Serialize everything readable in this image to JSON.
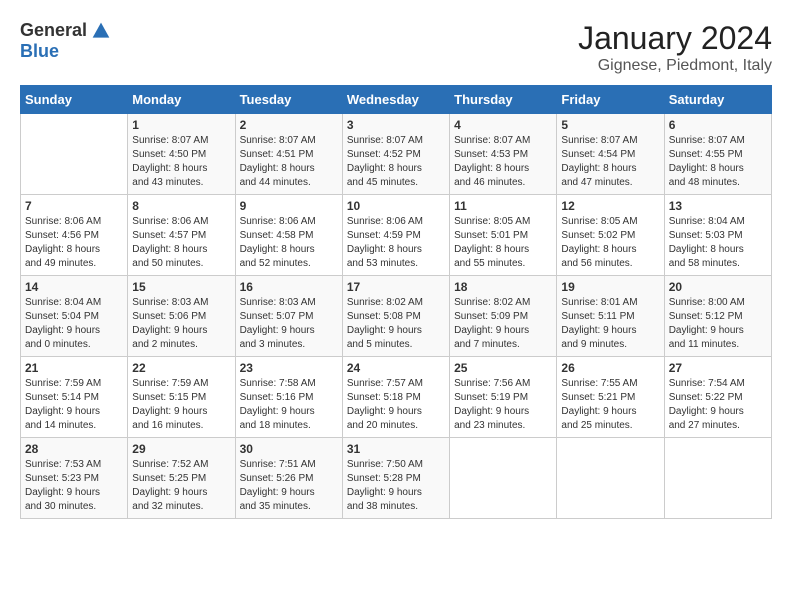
{
  "header": {
    "logo_general": "General",
    "logo_blue": "Blue",
    "month_year": "January 2024",
    "location": "Gignese, Piedmont, Italy"
  },
  "days_of_week": [
    "Sunday",
    "Monday",
    "Tuesday",
    "Wednesday",
    "Thursday",
    "Friday",
    "Saturday"
  ],
  "weeks": [
    [
      {
        "day": "",
        "info": ""
      },
      {
        "day": "1",
        "info": "Sunrise: 8:07 AM\nSunset: 4:50 PM\nDaylight: 8 hours\nand 43 minutes."
      },
      {
        "day": "2",
        "info": "Sunrise: 8:07 AM\nSunset: 4:51 PM\nDaylight: 8 hours\nand 44 minutes."
      },
      {
        "day": "3",
        "info": "Sunrise: 8:07 AM\nSunset: 4:52 PM\nDaylight: 8 hours\nand 45 minutes."
      },
      {
        "day": "4",
        "info": "Sunrise: 8:07 AM\nSunset: 4:53 PM\nDaylight: 8 hours\nand 46 minutes."
      },
      {
        "day": "5",
        "info": "Sunrise: 8:07 AM\nSunset: 4:54 PM\nDaylight: 8 hours\nand 47 minutes."
      },
      {
        "day": "6",
        "info": "Sunrise: 8:07 AM\nSunset: 4:55 PM\nDaylight: 8 hours\nand 48 minutes."
      }
    ],
    [
      {
        "day": "7",
        "info": "Sunrise: 8:06 AM\nSunset: 4:56 PM\nDaylight: 8 hours\nand 49 minutes."
      },
      {
        "day": "8",
        "info": "Sunrise: 8:06 AM\nSunset: 4:57 PM\nDaylight: 8 hours\nand 50 minutes."
      },
      {
        "day": "9",
        "info": "Sunrise: 8:06 AM\nSunset: 4:58 PM\nDaylight: 8 hours\nand 52 minutes."
      },
      {
        "day": "10",
        "info": "Sunrise: 8:06 AM\nSunset: 4:59 PM\nDaylight: 8 hours\nand 53 minutes."
      },
      {
        "day": "11",
        "info": "Sunrise: 8:05 AM\nSunset: 5:01 PM\nDaylight: 8 hours\nand 55 minutes."
      },
      {
        "day": "12",
        "info": "Sunrise: 8:05 AM\nSunset: 5:02 PM\nDaylight: 8 hours\nand 56 minutes."
      },
      {
        "day": "13",
        "info": "Sunrise: 8:04 AM\nSunset: 5:03 PM\nDaylight: 8 hours\nand 58 minutes."
      }
    ],
    [
      {
        "day": "14",
        "info": "Sunrise: 8:04 AM\nSunset: 5:04 PM\nDaylight: 9 hours\nand 0 minutes."
      },
      {
        "day": "15",
        "info": "Sunrise: 8:03 AM\nSunset: 5:06 PM\nDaylight: 9 hours\nand 2 minutes."
      },
      {
        "day": "16",
        "info": "Sunrise: 8:03 AM\nSunset: 5:07 PM\nDaylight: 9 hours\nand 3 minutes."
      },
      {
        "day": "17",
        "info": "Sunrise: 8:02 AM\nSunset: 5:08 PM\nDaylight: 9 hours\nand 5 minutes."
      },
      {
        "day": "18",
        "info": "Sunrise: 8:02 AM\nSunset: 5:09 PM\nDaylight: 9 hours\nand 7 minutes."
      },
      {
        "day": "19",
        "info": "Sunrise: 8:01 AM\nSunset: 5:11 PM\nDaylight: 9 hours\nand 9 minutes."
      },
      {
        "day": "20",
        "info": "Sunrise: 8:00 AM\nSunset: 5:12 PM\nDaylight: 9 hours\nand 11 minutes."
      }
    ],
    [
      {
        "day": "21",
        "info": "Sunrise: 7:59 AM\nSunset: 5:14 PM\nDaylight: 9 hours\nand 14 minutes."
      },
      {
        "day": "22",
        "info": "Sunrise: 7:59 AM\nSunset: 5:15 PM\nDaylight: 9 hours\nand 16 minutes."
      },
      {
        "day": "23",
        "info": "Sunrise: 7:58 AM\nSunset: 5:16 PM\nDaylight: 9 hours\nand 18 minutes."
      },
      {
        "day": "24",
        "info": "Sunrise: 7:57 AM\nSunset: 5:18 PM\nDaylight: 9 hours\nand 20 minutes."
      },
      {
        "day": "25",
        "info": "Sunrise: 7:56 AM\nSunset: 5:19 PM\nDaylight: 9 hours\nand 23 minutes."
      },
      {
        "day": "26",
        "info": "Sunrise: 7:55 AM\nSunset: 5:21 PM\nDaylight: 9 hours\nand 25 minutes."
      },
      {
        "day": "27",
        "info": "Sunrise: 7:54 AM\nSunset: 5:22 PM\nDaylight: 9 hours\nand 27 minutes."
      }
    ],
    [
      {
        "day": "28",
        "info": "Sunrise: 7:53 AM\nSunset: 5:23 PM\nDaylight: 9 hours\nand 30 minutes."
      },
      {
        "day": "29",
        "info": "Sunrise: 7:52 AM\nSunset: 5:25 PM\nDaylight: 9 hours\nand 32 minutes."
      },
      {
        "day": "30",
        "info": "Sunrise: 7:51 AM\nSunset: 5:26 PM\nDaylight: 9 hours\nand 35 minutes."
      },
      {
        "day": "31",
        "info": "Sunrise: 7:50 AM\nSunset: 5:28 PM\nDaylight: 9 hours\nand 38 minutes."
      },
      {
        "day": "",
        "info": ""
      },
      {
        "day": "",
        "info": ""
      },
      {
        "day": "",
        "info": ""
      }
    ]
  ]
}
